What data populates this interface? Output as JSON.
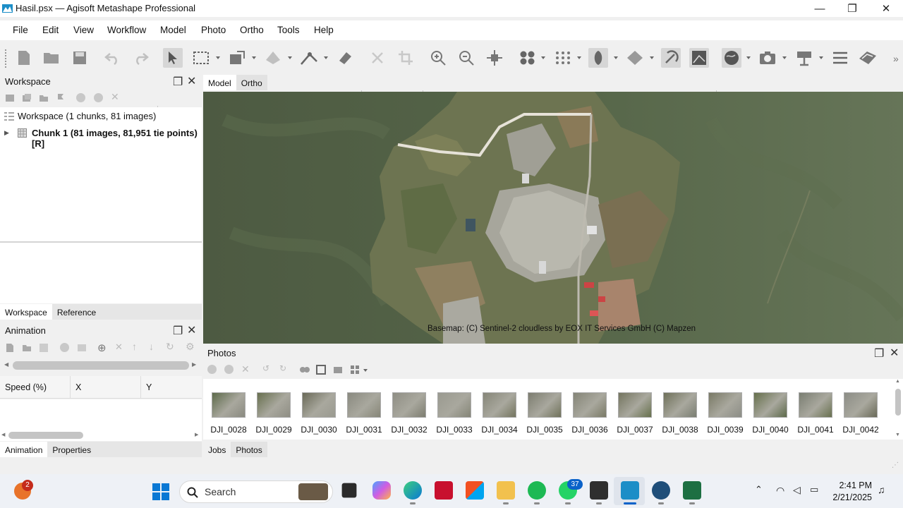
{
  "window": {
    "title": "Hasil.psx — Agisoft Metashape Professional",
    "minimize_glyph": "—",
    "maximize_glyph": "❐",
    "close_glyph": "✕"
  },
  "menu": [
    "File",
    "Edit",
    "View",
    "Workflow",
    "Model",
    "Photo",
    "Ortho",
    "Tools",
    "Help"
  ],
  "workspace": {
    "title": "Workspace",
    "root_label": "Workspace (1 chunks, 81 images)",
    "chunk_label": "Chunk 1 (81 images, 81,951 tie points) [R]",
    "tabs": [
      "Workspace",
      "Reference"
    ]
  },
  "animation": {
    "title": "Animation",
    "columns": [
      "Speed (%)",
      "X",
      "Y"
    ],
    "tabs": [
      "Animation",
      "Properties"
    ]
  },
  "view_tabs": [
    "Model",
    "Ortho"
  ],
  "basemap_attribution": "Basemap: (C) Sentinel-2 cloudless by EOX IT Services GmbH (C) Mapzen",
  "photos": {
    "title": "Photos",
    "items": [
      "DJI_0028",
      "DJI_0029",
      "DJI_0030",
      "DJI_0031",
      "DJI_0032",
      "DJI_0033",
      "DJI_0034",
      "DJI_0035",
      "DJI_0036",
      "DJI_0037",
      "DJI_0038",
      "DJI_0039",
      "DJI_0040",
      "DJI_0041",
      "DJI_0042"
    ],
    "bottom_tabs": [
      "Jobs",
      "Photos"
    ]
  },
  "taskbar": {
    "search_label": "Search",
    "notification_badge": "2",
    "whatsapp_badge": "37",
    "time": "2:41 PM",
    "date": "2/21/2025"
  },
  "colors": {
    "accent": "#0a62c9",
    "viewport_bg": "#4d5e43"
  }
}
